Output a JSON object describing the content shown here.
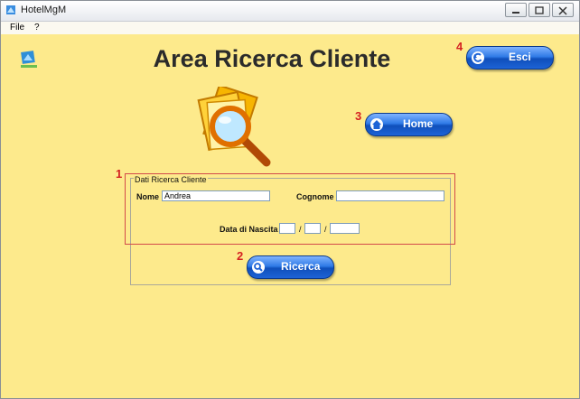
{
  "window": {
    "title": "HotelMgM",
    "icon": "app-icon",
    "controls": [
      "minimize-icon",
      "restore-icon",
      "close-icon"
    ]
  },
  "menu": {
    "items": [
      "File",
      "?"
    ]
  },
  "page": {
    "heading": "Area Ricerca Cliente",
    "logo": "hotel-logo-icon",
    "illustration": "search-documents-icon"
  },
  "buttons": {
    "exit": {
      "label": "Esci",
      "icon": "back-arrow-icon"
    },
    "home": {
      "label": "Home",
      "icon": "house-icon"
    },
    "search": {
      "label": "Ricerca",
      "icon": "magnifier-icon"
    }
  },
  "form": {
    "legend": "Dati Ricerca Cliente",
    "name_label": "Nome",
    "name_value": "Andrea",
    "surname_label": "Cognome",
    "surname_value": "",
    "birthdate_label": "Data di Nascita",
    "day_value": "",
    "month_value": "",
    "year_value": "",
    "separator": "/"
  },
  "annotations": [
    "1",
    "2",
    "3",
    "4"
  ],
  "colors": {
    "background": "#fdea8c",
    "button": "#1d63d6",
    "annotation": "#d42121"
  }
}
